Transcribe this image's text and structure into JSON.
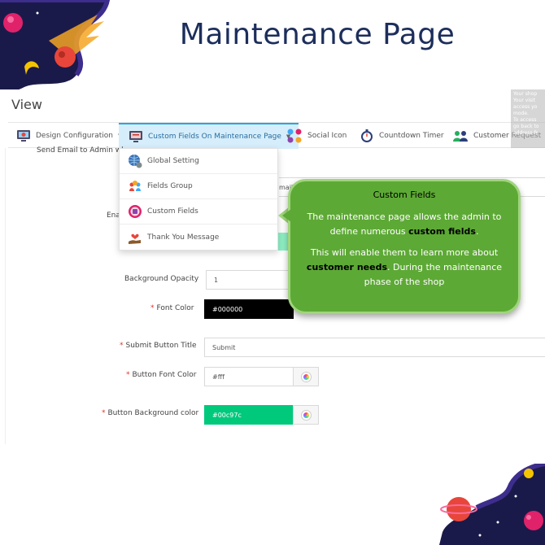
{
  "headline": "Maintenance Page",
  "view_title": "View",
  "tabs": [
    {
      "label": "Design Configuration",
      "icon": "monitor-gear-icon",
      "active": false
    },
    {
      "label": "Custom Fields On Maintenance Page",
      "icon": "monitor-form-icon",
      "active": true
    },
    {
      "label": "Social Icon",
      "icon": "social-dots-icon",
      "active": false
    },
    {
      "label": "Countdown Timer",
      "icon": "stopwatch-icon",
      "active": false
    },
    {
      "label": "Customer Request",
      "icon": "people-icon",
      "active": false
    }
  ],
  "overlay_text": [
    "Your shop",
    "Your visit",
    "access yo",
    "mode.",
    "To access",
    "go back to",
    "address fr"
  ],
  "dropdown": [
    {
      "label": "Global Setting",
      "icon": "globe-gear-icon"
    },
    {
      "label": "Fields Group",
      "icon": "people-group-icon"
    },
    {
      "label": "Custom Fields",
      "icon": "custom-field-icon"
    },
    {
      "label": "Thank You Message",
      "icon": "hand-heart-icon"
    }
  ],
  "form": {
    "send_email_label": "Send Email to Admin whe",
    "email_partial": "mail.co",
    "enable_label": "Enab",
    "bg_opacity_label": "Background Opacity",
    "bg_opacity_value": "1",
    "font_color_label": "Font Color",
    "font_color_value": "#000000",
    "submit_title_label": "Submit Button Title",
    "submit_title_value": "Submit",
    "btn_font_color_label": "Button Font Color",
    "btn_font_color_value": "#fff",
    "btn_bg_color_label": "Button Background color",
    "btn_bg_color_value": "#00c97c"
  },
  "callout": {
    "title": "Custom Fields",
    "p1_a": "The maintenance page allows the admin to define numerous ",
    "p1_em": "custom fields",
    "p1_b": ".",
    "p2_a": "This will enable them to learn more about ",
    "p2_em": "customer needs",
    "p2_b": ". During the maintenance phase of the shop"
  },
  "colors": {
    "headline": "#1c2e5b",
    "active_tab_bg": "#d6eefb",
    "callout_bg": "#5da935",
    "font_color_swatch": "#000000",
    "btn_bg_swatch": "#00c97c"
  }
}
